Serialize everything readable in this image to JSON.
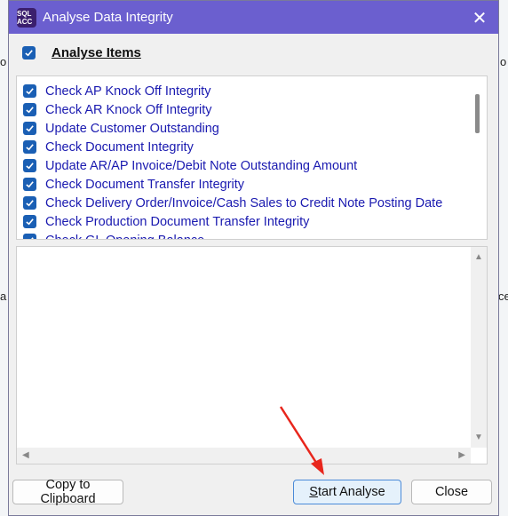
{
  "window": {
    "title": "Analyse Data Integrity",
    "app_icon_text": "SQL ACC",
    "close_label": "✕"
  },
  "header": {
    "label": "Analyse Items",
    "checked": true
  },
  "items": [
    {
      "label": "Check AP Knock Off Integrity",
      "checked": true
    },
    {
      "label": "Check AR Knock Off Integrity",
      "checked": true
    },
    {
      "label": "Update Customer Outstanding",
      "checked": true
    },
    {
      "label": "Check Document Integrity",
      "checked": true
    },
    {
      "label": "Update AR/AP Invoice/Debit Note Outstanding Amount",
      "checked": true
    },
    {
      "label": "Check Document Transfer Integrity",
      "checked": true
    },
    {
      "label": "Check Delivery Order/Invoice/Cash Sales to Credit Note Posting Date",
      "checked": true
    },
    {
      "label": "Check Production Document Transfer Integrity",
      "checked": true
    },
    {
      "label": "Check GL Opening Balance",
      "checked": true
    }
  ],
  "buttons": {
    "copy": "Copy to Clipboard",
    "start_first": "S",
    "start_rest": "tart Analyse",
    "close": "Close"
  },
  "background": {
    "left_glyph_1": "o",
    "left_glyph_2": "a",
    "right_glyph_1": "o",
    "right_glyph_2": "ce"
  },
  "colors": {
    "titlebar": "#6b5fcf",
    "checkbox": "#1a5fb4",
    "item_text": "#1a1ab0",
    "primary_button_border": "#4a8ad8",
    "annotation_arrow": "#e8261c"
  }
}
